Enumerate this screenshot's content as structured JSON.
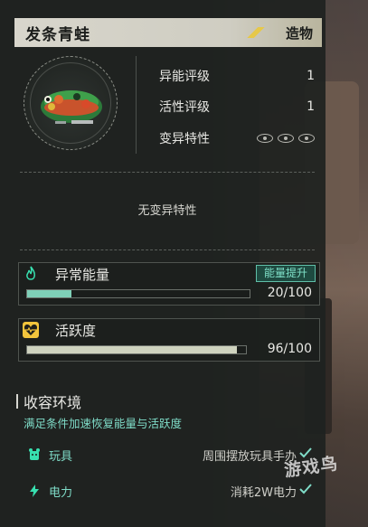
{
  "header": {
    "title": "发条青蛙",
    "tag": "造物"
  },
  "stats": [
    {
      "label": "异能评级",
      "value": "1"
    },
    {
      "label": "活性评级",
      "value": "1"
    },
    {
      "label": "变异特性",
      "value": ""
    }
  ],
  "mutation_empty": "无变异特性",
  "energy": {
    "label": "异常能量",
    "button": "能量提升",
    "value_text": "20/100",
    "fraction": 0.2
  },
  "activity": {
    "label": "活跃度",
    "value_text": "96/100",
    "fraction": 0.96
  },
  "containment": {
    "title": "收容环境",
    "subtitle": "满足条件加速恢复能量与活跃度",
    "conditions": [
      {
        "name": "玩具",
        "requirement": "周围摆放玩具手办",
        "icon": "toy-icon"
      },
      {
        "name": "电力",
        "requirement": "消耗2W电力",
        "icon": "lightning-icon"
      }
    ]
  },
  "watermark": "游戏鸟",
  "colors": {
    "accent": "#7fdcc8",
    "energy_fill": "#7fd0b8",
    "activity_fill": "#cfd3bf",
    "tag_yellow": "#e6c84a",
    "fire": "#38e0b0",
    "heart": "#f2c43c"
  }
}
